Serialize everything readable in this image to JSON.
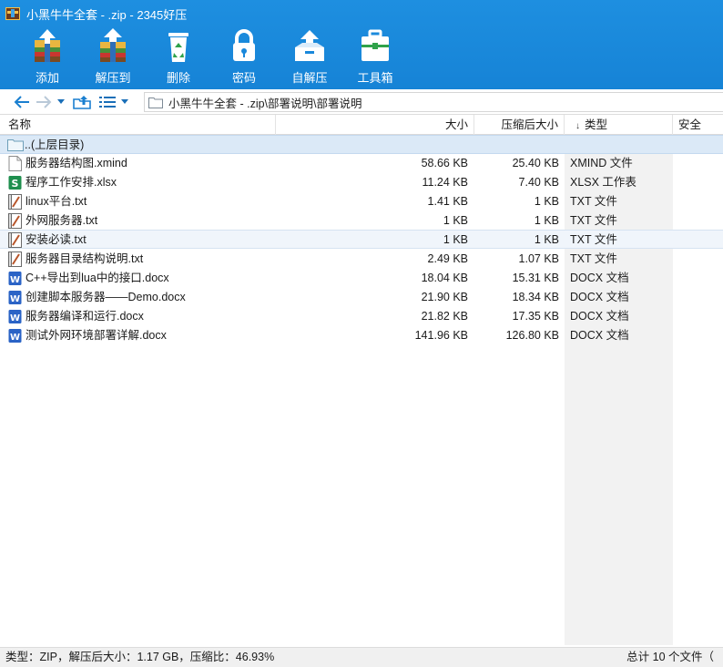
{
  "window": {
    "title": "小黑牛牛全套 - .zip - 2345好压"
  },
  "toolbar": {
    "items": [
      {
        "label": "添加",
        "icon": "add-archive-icon"
      },
      {
        "label": "解压到",
        "icon": "extract-to-icon"
      },
      {
        "label": "删除",
        "icon": "recycle-bin-icon"
      },
      {
        "label": "密码",
        "icon": "lock-icon"
      },
      {
        "label": "自解压",
        "icon": "self-extract-icon"
      },
      {
        "label": "工具箱",
        "icon": "toolbox-icon"
      }
    ]
  },
  "address": {
    "path": "小黑牛牛全套 - .zip\\部署说明\\部署说明"
  },
  "columns": {
    "name": "名称",
    "size": "大小",
    "packed": "压缩后大小",
    "sort_arrow": "↓",
    "type": "类型",
    "security": "安全"
  },
  "parent_row": {
    "label": "..(上层目录)"
  },
  "files": [
    {
      "name": "服务器结构图.xmind",
      "size": "58.66 KB",
      "packed": "25.40 KB",
      "type": "XMIND 文件",
      "icon": "xmind-file-icon"
    },
    {
      "name": "程序工作安排.xlsx",
      "size": "11.24 KB",
      "packed": "7.40 KB",
      "type": "XLSX 工作表",
      "icon": "xlsx-file-icon"
    },
    {
      "name": "linux平台.txt",
      "size": "1.41 KB",
      "packed": "1 KB",
      "type": "TXT 文件",
      "icon": "txt-file-icon"
    },
    {
      "name": "外网服务器.txt",
      "size": "1 KB",
      "packed": "1 KB",
      "type": "TXT 文件",
      "icon": "txt-file-icon"
    },
    {
      "name": "安装必读.txt",
      "size": "1 KB",
      "packed": "1 KB",
      "type": "TXT 文件",
      "icon": "txt-file-icon"
    },
    {
      "name": "服务器目录结构说明.txt",
      "size": "2.49 KB",
      "packed": "1.07 KB",
      "type": "TXT 文件",
      "icon": "txt-file-icon"
    },
    {
      "name": "C++导出到lua中的接口.docx",
      "size": "18.04 KB",
      "packed": "15.31 KB",
      "type": "DOCX 文档",
      "icon": "docx-file-icon"
    },
    {
      "name": "创建脚本服务器——Demo.docx",
      "size": "21.90 KB",
      "packed": "18.34 KB",
      "type": "DOCX 文档",
      "icon": "docx-file-icon"
    },
    {
      "name": "服务器编译和运行.docx",
      "size": "21.82 KB",
      "packed": "17.35 KB",
      "type": "DOCX 文档",
      "icon": "docx-file-icon"
    },
    {
      "name": "测试外网环境部署详解.docx",
      "size": "141.96 KB",
      "packed": "126.80 KB",
      "type": "DOCX 文档",
      "icon": "docx-file-icon"
    }
  ],
  "status": {
    "left": "类型：ZIP，解压后大小：1.17 GB，压缩比：46.93%",
    "right": "总计 10 个文件（"
  },
  "colors": {
    "accent": "#1a88db",
    "selection": "#dbe9f7",
    "type_column": "#f2f2f2"
  }
}
